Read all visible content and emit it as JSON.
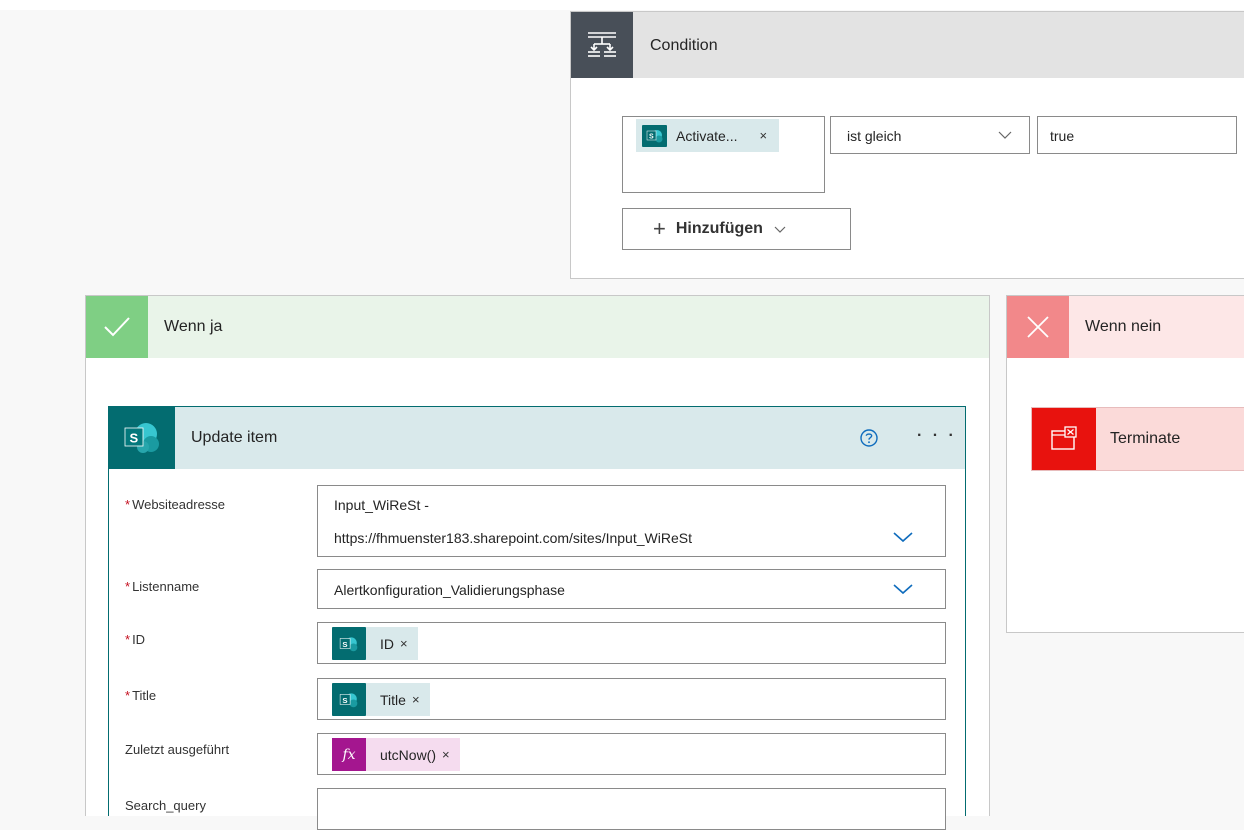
{
  "condition": {
    "title": "Condition",
    "token_label": "Activate...",
    "token_close": "×",
    "operator": "ist gleich",
    "value": "true",
    "add_button": "Hinzufügen"
  },
  "branch_yes": {
    "title": "Wenn ja"
  },
  "branch_no": {
    "title": "Wenn nein",
    "terminate_title": "Terminate"
  },
  "update_item": {
    "title": "Update item",
    "more": "· · ·",
    "fields": {
      "site": {
        "label": "Websiteadresse",
        "line1": "Input_WiReSt -",
        "line2": "https://fhmuenster183.sharepoint.com/sites/Input_WiReSt"
      },
      "list": {
        "label": "Listenname",
        "value": "Alertkonfiguration_Validierungsphase"
      },
      "id": {
        "label": "ID",
        "token": "ID",
        "close": "×"
      },
      "title": {
        "label": "Title",
        "token": "Title",
        "close": "×"
      },
      "last_run": {
        "label": "Zuletzt ausgeführt",
        "token": "utcNow()",
        "close": "×"
      },
      "search": {
        "label": "Search_query"
      }
    },
    "required_mark": "*",
    "fx_glyph": "fx"
  },
  "colors": {
    "sharepoint": "#036c70",
    "token_bg": "#d9e9eb",
    "expression": "#a4168f",
    "yes_accent": "#7fcf84",
    "no_accent": "#f2888a",
    "terminate": "#e8120e",
    "link_blue": "#0f6cbd"
  }
}
